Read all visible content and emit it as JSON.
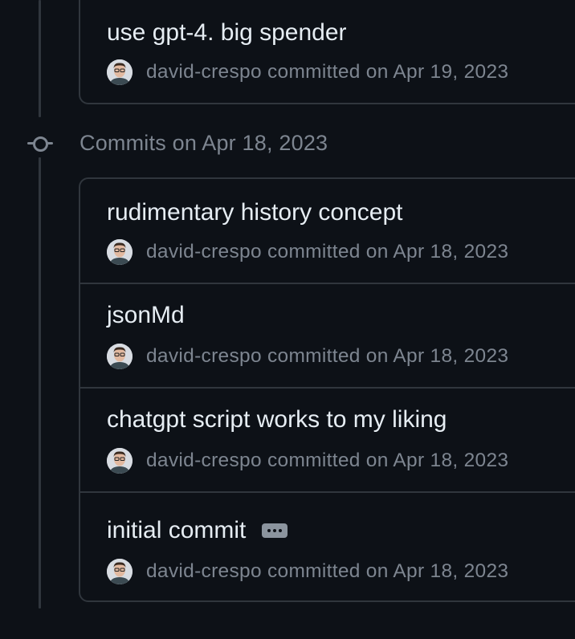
{
  "top_commit": {
    "message": "use gpt-4. big spender",
    "author": "david-crespo",
    "committed_text": "committed on Apr 19, 2023"
  },
  "group": {
    "title": "Commits on Apr 18, 2023",
    "commits": [
      {
        "message": "rudimentary history concept",
        "author": "david-crespo",
        "committed_text": "committed on Apr 18, 2023"
      },
      {
        "message": "jsonMd",
        "author": "david-crespo",
        "committed_text": "committed on Apr 18, 2023"
      },
      {
        "message": "chatgpt script works to my liking",
        "author": "david-crespo",
        "committed_text": "committed on Apr 18, 2023"
      },
      {
        "message": "initial commit",
        "author": "david-crespo",
        "committed_text": "committed on Apr 18, 2023",
        "has_expand_button": true
      }
    ]
  },
  "icons": {
    "commit_node": "git-commit-icon",
    "expand": "kebab-horizontal-icon",
    "avatar": "user-avatar"
  }
}
